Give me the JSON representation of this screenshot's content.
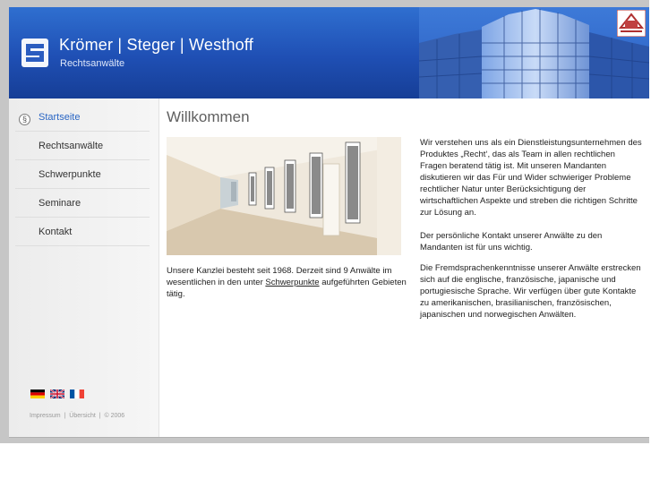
{
  "header": {
    "firm_name": "Krömer | Steger | Westhoff",
    "firm_subtitle": "Rechtsanwälte"
  },
  "sidebar": {
    "items": [
      {
        "label": "Startseite",
        "active": true
      },
      {
        "label": "Rechtsanwälte"
      },
      {
        "label": "Schwerpunkte"
      },
      {
        "label": "Seminare"
      },
      {
        "label": "Kontakt"
      }
    ],
    "active_bullet": "§",
    "languages": [
      "flag-de-icon",
      "flag-uk-icon",
      "flag-fr-icon"
    ],
    "footer": {
      "impressum": "Impressum",
      "sep": "|",
      "uebersicht": "Übersicht",
      "copyright": "© 2006"
    }
  },
  "main": {
    "title": "Willkommen",
    "intro_before": "Unsere Kanzlei besteht seit 1968. Derzeit sind 9 Anwälte im wesentlichen in den unter ",
    "intro_link": "Schwerpunkte",
    "intro_after": " aufgeführten Gebieten tätig.",
    "paragraphs": [
      "Wir verstehen uns als ein Dienstleistungsunternehmen des Produktes „Recht‘, das als Team in allen rechtlichen Fragen beratend tätig ist. Mit unseren Mandanten diskutieren wir das Für und Wider schwieriger Probleme rechtlicher Natur unter Berücksichtigung der wirtschaftlichen Aspekte und streben die richtigen Schritte zur Lösung an.",
      "Der persönliche Kontakt unserer Anwälte zu den Mandanten ist für uns wichtig.",
      "Die Fremdsprachenkenntnisse unserer Anwälte erstrecken sich auf die englische, französische, japanische und portugiesische Sprache. Wir verfügen über gute Kontakte zu amerikanischen, brasilianischen, französischen, japanischen und norwegischen Anwälten."
    ]
  },
  "colors": {
    "header_blue": "#1f4fb4",
    "active_link": "#2a66c4",
    "frame_gray": "#c6c6c6"
  }
}
